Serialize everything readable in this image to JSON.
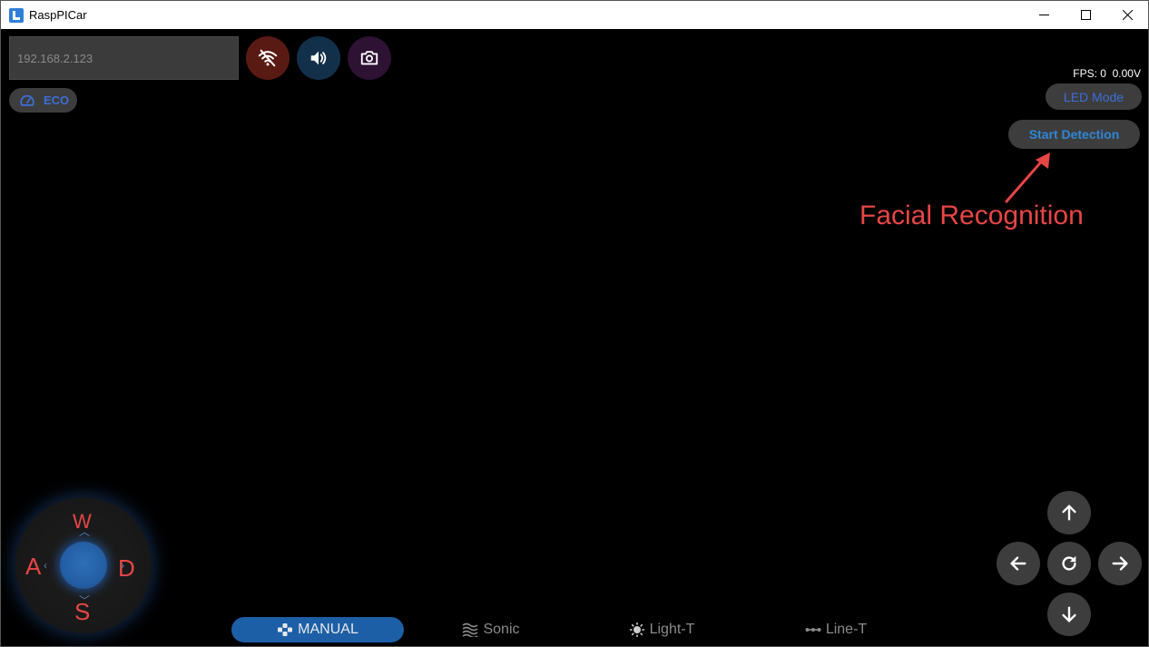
{
  "window": {
    "title": "RaspPICar"
  },
  "connection": {
    "ip_value": "192.168.2.123"
  },
  "eco": {
    "label": "ECO"
  },
  "status": {
    "fps_text": "FPS: 0  0.00V"
  },
  "led": {
    "label": "LED Mode"
  },
  "detection": {
    "label": "Start Detection"
  },
  "annotation": {
    "text": "Facial Recognition"
  },
  "joystick": {
    "up": "W",
    "left": "A",
    "right": "D",
    "down": "S"
  },
  "modes": {
    "manual": "MANUAL",
    "sonic": "Sonic",
    "light": "Light-T",
    "line": "Line-T"
  },
  "colors": {
    "accent_blue": "#1c5fa6",
    "annotation_red": "#e84545",
    "button_gray": "#3d3d3d"
  }
}
